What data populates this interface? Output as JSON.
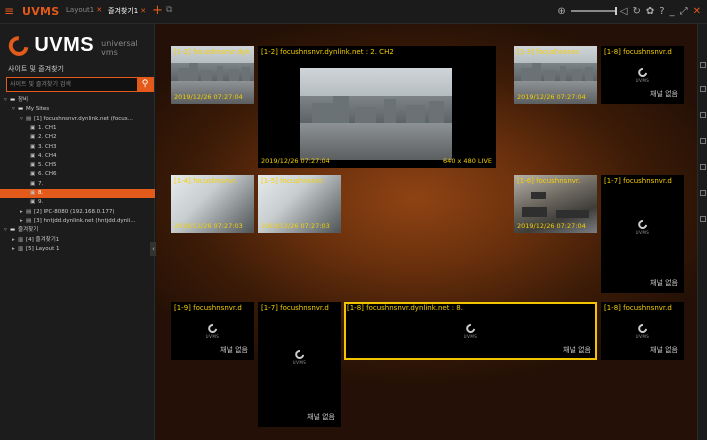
{
  "app": {
    "name": "UVMS",
    "tabs": [
      {
        "label": "Layout1",
        "active": false
      },
      {
        "label": "즐겨찾기1",
        "active": true
      }
    ]
  },
  "sidebar": {
    "logo_text": "UVMS",
    "logo_sub": "universal vms",
    "section_title": "사이트 및 즐겨찾기",
    "search_placeholder": "사이트 및 즐겨찾기 검색",
    "tree": [
      {
        "label": "장비",
        "level": 0,
        "expanded": true,
        "kind": "folder"
      },
      {
        "label": "My Sites",
        "level": 1,
        "expanded": true,
        "kind": "folder"
      },
      {
        "label": "[1] focushnsnvr.dynlink.net (focus...",
        "level": 2,
        "expanded": true,
        "kind": "nvr"
      },
      {
        "label": "1. CH1",
        "level": 3,
        "kind": "cam"
      },
      {
        "label": "2. CH2",
        "level": 3,
        "kind": "cam"
      },
      {
        "label": "3. CH3",
        "level": 3,
        "kind": "cam"
      },
      {
        "label": "4. CH4",
        "level": 3,
        "kind": "cam"
      },
      {
        "label": "5. CH5",
        "level": 3,
        "kind": "cam"
      },
      {
        "label": "6. CH6",
        "level": 3,
        "kind": "cam"
      },
      {
        "label": "7.",
        "level": 3,
        "kind": "cam"
      },
      {
        "label": "8.",
        "level": 3,
        "kind": "cam",
        "selected": true
      },
      {
        "label": "9.",
        "level": 3,
        "kind": "cam"
      },
      {
        "label": "[2] IPC-8080 (192.168.0.177)",
        "level": 2,
        "expanded": false,
        "kind": "nvr"
      },
      {
        "label": "[3] hntjdd.dynlink.net (hntjdd.dynli...",
        "level": 2,
        "expanded": false,
        "kind": "nvr"
      },
      {
        "label": "즐겨찾기",
        "level": 0,
        "expanded": true,
        "kind": "folder"
      },
      {
        "label": "[4] 즐겨찾기1",
        "level": 1,
        "expanded": false,
        "kind": "fav"
      },
      {
        "label": "[5] Layout 1",
        "level": 1,
        "expanded": false,
        "kind": "fav"
      }
    ]
  },
  "tiles": [
    {
      "id": "t1",
      "label": "[1-2] focushnsnvr.dyn",
      "time": "2019/12/26 07:27:04",
      "scene": "city"
    },
    {
      "id": "t2",
      "label": "[1-2] focushnsnvr.dynlink.net : 2. CH2",
      "time": "2019/12/26 07:27:04",
      "res": "640 x 480  LIVE",
      "scene": "city-big"
    },
    {
      "id": "t3",
      "label": "[1-3] focushnsnvr.",
      "time": "2019/12/26 07:27:04",
      "scene": "city"
    },
    {
      "id": "t4",
      "label": "[1-8] focushnsnvr.d",
      "no_channel": "채널 없음",
      "logo": "UVMS"
    },
    {
      "id": "t5",
      "label": "[1-4] focushnsnvr.",
      "time": "2019/12/26 07:27:03",
      "scene": "snow"
    },
    {
      "id": "t6",
      "label": "[1-5] focushnsnvr.",
      "time": "2019/12/26 07:27:03",
      "scene": "snow"
    },
    {
      "id": "t7",
      "label": "[1-6] focushnsnvr.",
      "time": "2019/12/26 07:27:04",
      "scene": "office"
    },
    {
      "id": "t8",
      "label": "[1-7] focushnsnvr.d",
      "no_channel": "채널 없음",
      "logo": "UVMS"
    },
    {
      "id": "t9",
      "label": "[1-9] focushnsnvr.d",
      "no_channel": "채널 없음",
      "logo": "UVMS"
    },
    {
      "id": "t10",
      "label": "[1-7] focushnsnvr.d",
      "no_channel": "채널 없음",
      "logo": "UVMS"
    },
    {
      "id": "t11",
      "label": "[1-8] focushnsnvr.dynlink.net : 8.",
      "no_channel": "채널 없음",
      "logo": "UVMS",
      "selected": true
    },
    {
      "id": "t12",
      "label": "[1-8] focushnsnvr.d",
      "no_channel": "채널 없음",
      "logo": "UVMS"
    }
  ],
  "colors": {
    "accent": "#e35a1a",
    "label": "#f5d000"
  }
}
